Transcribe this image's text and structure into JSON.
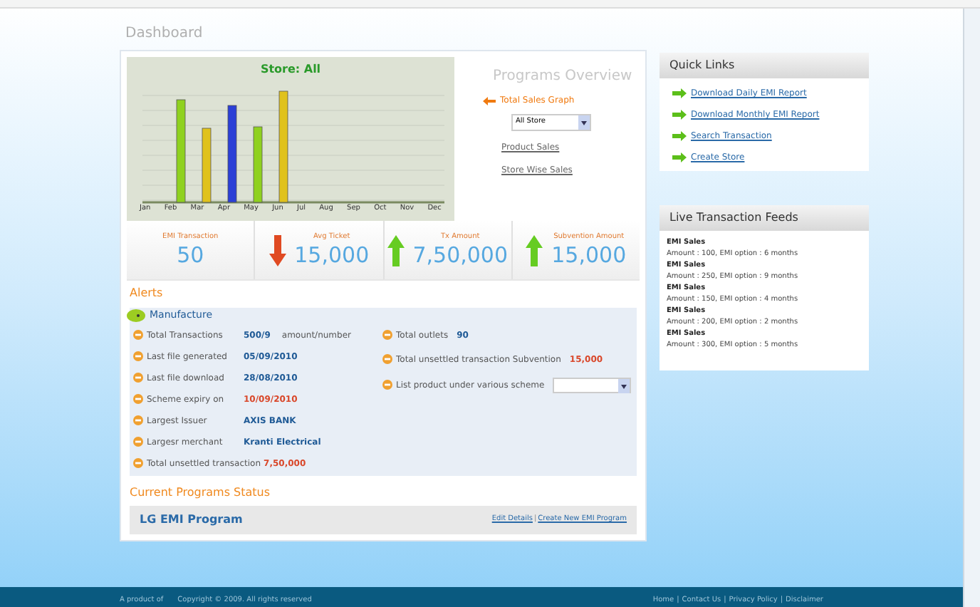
{
  "page_title": "Dashboard",
  "chart": {
    "title": "Store: All",
    "months": [
      "Jan",
      "Feb",
      "Mar",
      "Apr",
      "May",
      "Jun",
      "Jul",
      "Aug",
      "Sep",
      "Oct",
      "Nov",
      "Dec"
    ]
  },
  "overview": {
    "title": "Programs Overview",
    "graph_link": "Total Sales Graph",
    "store_select": "All Store",
    "links": [
      "Product Sales",
      "Store Wise Sales"
    ]
  },
  "stats": [
    {
      "label": "EMI Transaction",
      "value": "50",
      "kind": "plain"
    },
    {
      "label": "Avg Ticket",
      "value": "15,000",
      "kind": "down"
    },
    {
      "label": "Tx Amount",
      "value": "7,50,000",
      "kind": "up"
    },
    {
      "label": "Subvention Amount",
      "value": "15,000",
      "kind": "up"
    }
  ],
  "alerts": {
    "title": "Alerts",
    "group": "Manufacture",
    "left": [
      {
        "label": "Total Transactions",
        "value": "500/9",
        "suffix": "amount/number",
        "color": "#1f5a96"
      },
      {
        "label": "Last file generated",
        "value": "05/09/2010",
        "color": "#1f5a96"
      },
      {
        "label": "Last file download",
        "value": "28/08/2010",
        "color": "#1f5a96"
      },
      {
        "label": "Scheme expiry on",
        "value": "10/09/2010",
        "color": "#d9482b"
      },
      {
        "label": "Largest Issuer",
        "value": "AXIS BANK",
        "color": "#1f5a96"
      },
      {
        "label": "Largesr merchant",
        "value": "Kranti Electrical",
        "color": "#1f5a96"
      },
      {
        "label": "Total unsettled transaction",
        "value": "7,50,000",
        "color": "#d9482b"
      }
    ],
    "right": [
      {
        "kind": "value",
        "label": "Total outlets",
        "value": "90",
        "color": "#1f5a96"
      },
      {
        "kind": "value",
        "label": "Total unsettled transaction Subvention",
        "value": "15,000",
        "color": "#d9482b"
      },
      {
        "kind": "select",
        "label": "List product under various scheme"
      }
    ]
  },
  "programs": {
    "title": "Current Programs Status",
    "name": "LG EMI Program",
    "links": [
      "Edit Details",
      "Create New EMI Program"
    ],
    "separator": "|"
  },
  "quick_links": {
    "title": "Quick Links",
    "items": [
      "Download Daily EMI Report",
      "Download Monthly EMI Report",
      "Search Transaction",
      "Create Store"
    ]
  },
  "feeds": {
    "title": "Live Transaction Feeds",
    "items": [
      {
        "title": "EMI Sales",
        "detail": "Amount : 100, EMI option : 6 months"
      },
      {
        "title": "EMI Sales",
        "detail": "Amount : 250, EMI option : 9 months"
      },
      {
        "title": "EMI Sales",
        "detail": "Amount : 150, EMI option : 4 months"
      },
      {
        "title": "EMI Sales",
        "detail": "Amount : 200, EMI option : 2 months"
      },
      {
        "title": "EMI Sales",
        "detail": "Amount : 300, EMI option : 5 months"
      }
    ]
  },
  "footer": {
    "left": "A product of",
    "copyright": "Copyright © 2009. All rights reserved",
    "links": [
      "Home",
      "Contact Us",
      "Privacy Policy",
      "Disclaimer"
    ],
    "separator": "|"
  }
}
